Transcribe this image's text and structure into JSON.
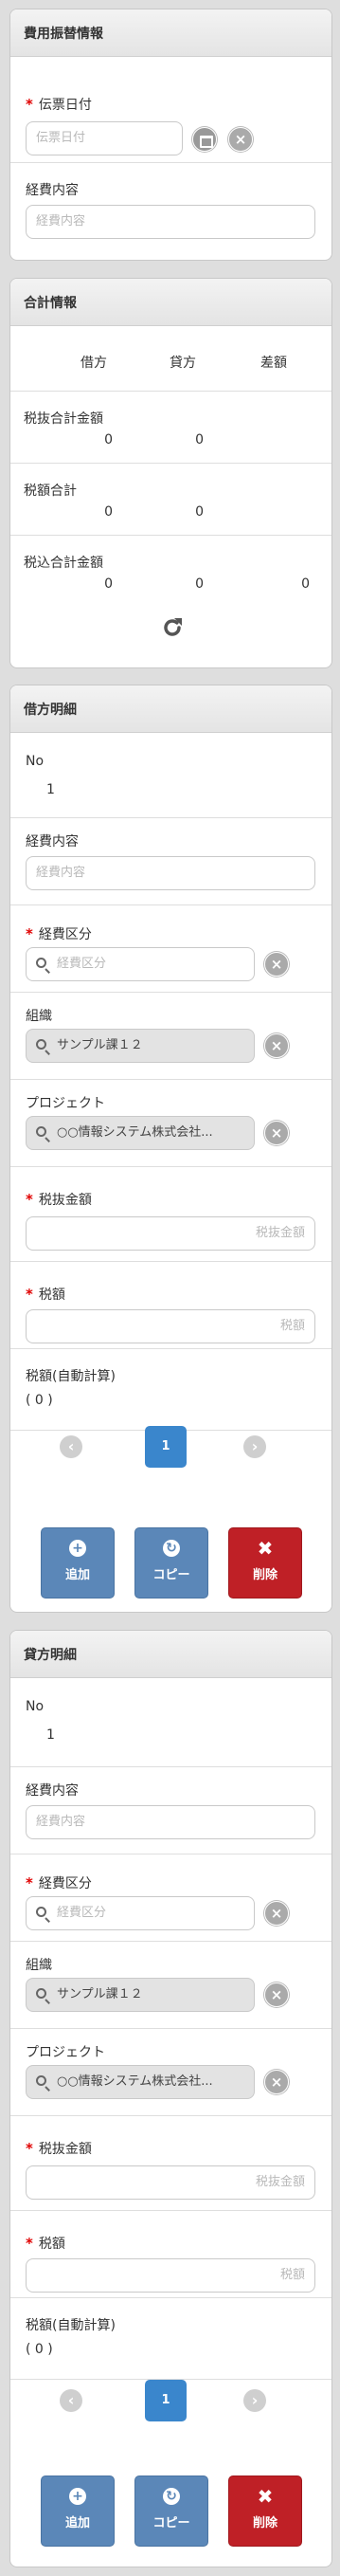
{
  "transfer": {
    "title": "費用振替情報",
    "date_label": "伝票日付",
    "date_placeholder": "伝票日付",
    "expense_label": "経費内容",
    "expense_placeholder": "経費内容"
  },
  "totals": {
    "title": "合計情報",
    "col_debit": "借方",
    "col_credit": "貸方",
    "col_diff": "差額",
    "rows": [
      {
        "label": "税抜合計金額",
        "debit": "0",
        "credit": "0",
        "diff": ""
      },
      {
        "label": "税額合計",
        "debit": "0",
        "credit": "0",
        "diff": ""
      },
      {
        "label": "税込合計金額",
        "debit": "0",
        "credit": "0",
        "diff": "0"
      }
    ]
  },
  "debit": {
    "title": "借方明細",
    "no_label": "No",
    "no_value": "1",
    "expense_label": "経費内容",
    "expense_placeholder": "経費内容",
    "category_label": "経費区分",
    "category_placeholder": "経費区分",
    "org_label": "組織",
    "org_value": "サンプル課１２",
    "project_label": "プロジェクト",
    "project_value": "○○情報システム株式会社...",
    "amount_label": "税抜金額",
    "amount_placeholder": "税抜金額",
    "tax_label": "税額",
    "tax_placeholder": "税額",
    "autotax_label": "税額(自動計算)",
    "autotax_value": "( 0 )",
    "page": "1",
    "add_label": "追加",
    "copy_label": "コピー",
    "delete_label": "削除"
  },
  "credit": {
    "title": "貸方明細",
    "no_label": "No",
    "no_value": "1",
    "expense_label": "経費内容",
    "expense_placeholder": "経費内容",
    "category_label": "経費区分",
    "category_placeholder": "経費区分",
    "org_label": "組織",
    "org_value": "サンプル課１２",
    "project_label": "プロジェクト",
    "project_value": "○○情報システム株式会社...",
    "amount_label": "税抜金額",
    "amount_placeholder": "税抜金額",
    "tax_label": "税額",
    "tax_placeholder": "税額",
    "autotax_label": "税額(自動計算)",
    "autotax_value": "( 0 )",
    "page": "1",
    "add_label": "追加",
    "copy_label": "コピー",
    "delete_label": "削除"
  }
}
